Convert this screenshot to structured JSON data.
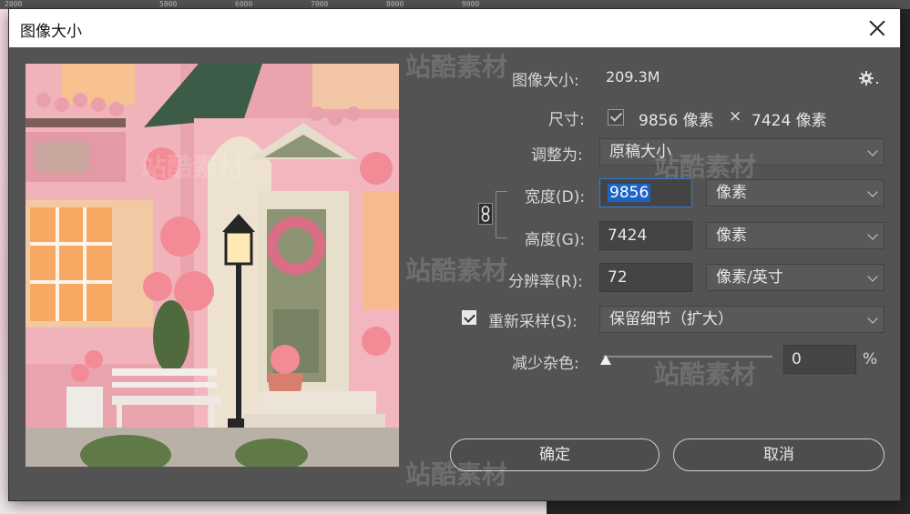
{
  "ruler": {
    "ticks": [
      "2000",
      "5000",
      "6000",
      "7000",
      "8000",
      "9000"
    ]
  },
  "dialog": {
    "title": "图像大小",
    "image_size_label": "图像大小:",
    "image_size_value": "209.3M",
    "dimensions_label": "尺寸:",
    "width_px_text": "9856 像素",
    "times_symbol": "×",
    "height_px_text": "7424 像素",
    "fit_to_label": "调整为:",
    "fit_to_value": "原稿大小",
    "width_label": "宽度(D):",
    "width_value": "9856",
    "width_unit": "像素",
    "height_label": "高度(G):",
    "height_value": "7424",
    "height_unit": "像素",
    "resolution_label": "分辨率(R):",
    "resolution_value": "72",
    "resolution_unit": "像素/英寸",
    "resample_label": "重新采样(S):",
    "resample_checked": true,
    "resample_value": "保留细节（扩大）",
    "noise_label": "减少杂色:",
    "noise_value": "0",
    "noise_unit": "%",
    "ok_label": "确定",
    "cancel_label": "取消"
  },
  "watermark": {
    "text": "站酷素材"
  },
  "icons": {
    "gear": "gear-icon",
    "close": "close-icon",
    "chain": "chain-link-icon"
  }
}
